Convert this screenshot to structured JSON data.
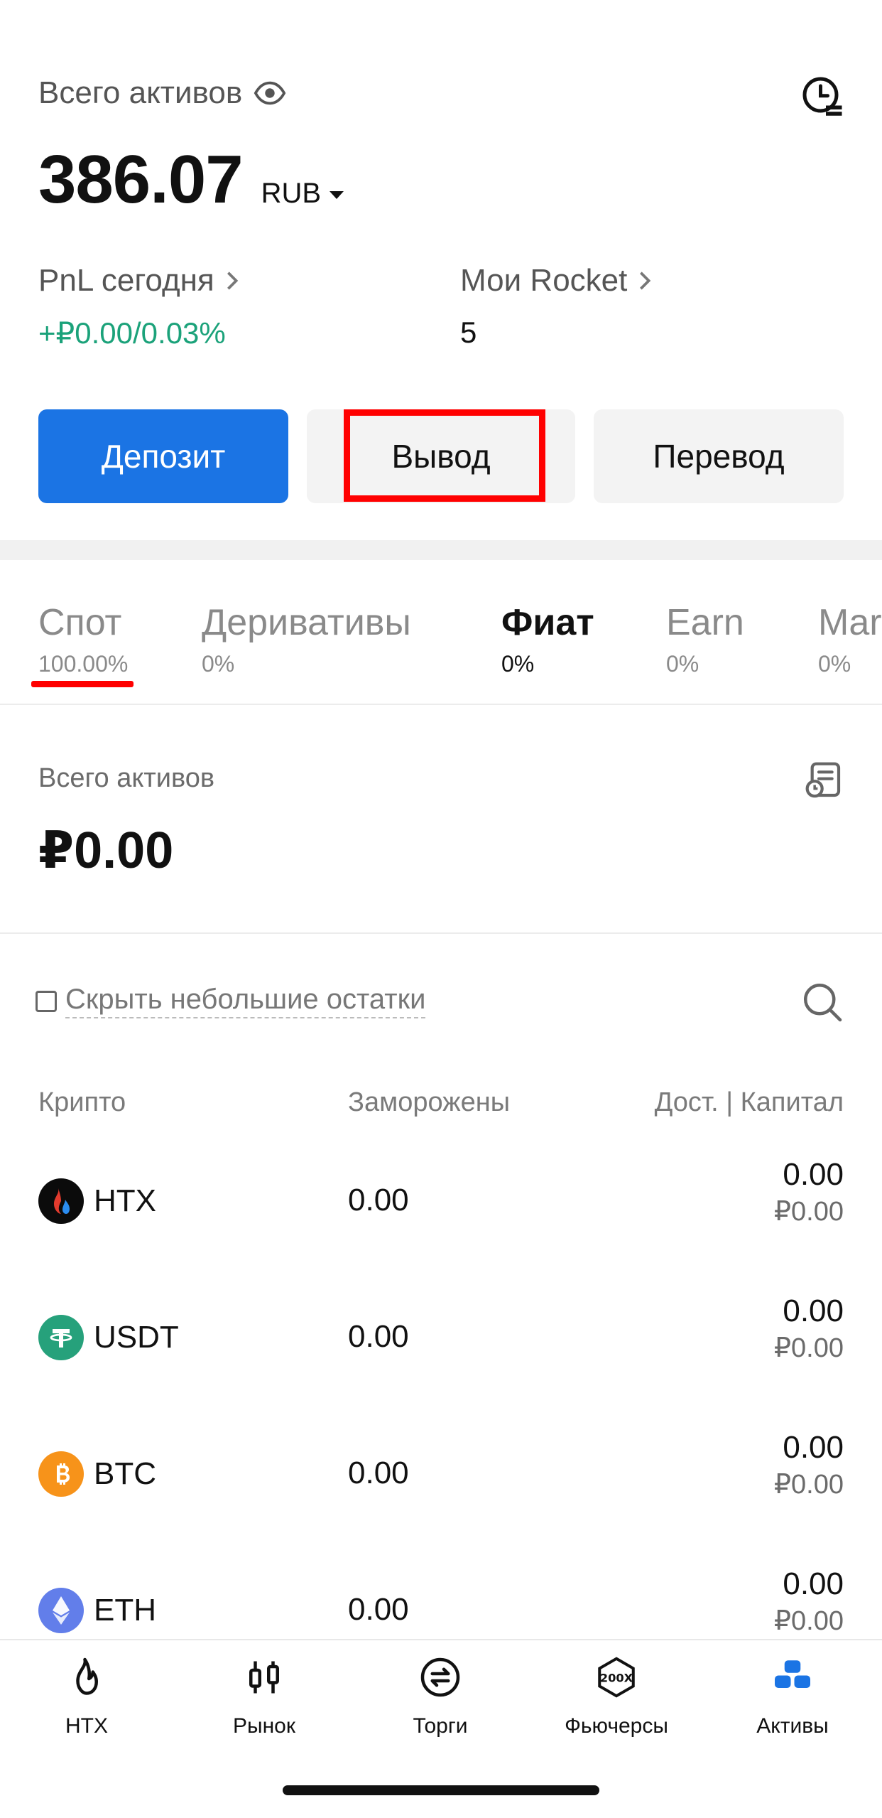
{
  "header": {
    "total_label": "Всего активов",
    "balance": "386.07",
    "currency": "RUB",
    "pnl_label": "PnL сегодня",
    "pnl_value": "+₽0.00/0.03%",
    "rocket_label": "Мои Rocket",
    "rocket_value": "5"
  },
  "buttons": {
    "deposit": "Депозит",
    "withdraw": "Вывод",
    "transfer": "Перевод"
  },
  "tabs": [
    {
      "label": "Спот",
      "pct": "100.00%"
    },
    {
      "label": "Деривативы",
      "pct": "0%"
    },
    {
      "label": "Фиат",
      "pct": "0%"
    },
    {
      "label": "Earn",
      "pct": "0%"
    },
    {
      "label": "Mar",
      "pct": "0%"
    }
  ],
  "section": {
    "assets_label": "Всего активов",
    "assets_value": "₽0.00",
    "hide_small": "Скрыть небольшие остатки"
  },
  "columns": {
    "crypto": "Крипто",
    "frozen": "Заморожены",
    "available": "Дост. | Капитал"
  },
  "rows": [
    {
      "name": "HTX",
      "frozen": "0.00",
      "avail": "0.00",
      "value": "₽0.00"
    },
    {
      "name": "USDT",
      "frozen": "0.00",
      "avail": "0.00",
      "value": "₽0.00"
    },
    {
      "name": "BTC",
      "frozen": "0.00",
      "avail": "0.00",
      "value": "₽0.00"
    },
    {
      "name": "ETH",
      "frozen": "0.00",
      "avail": "0.00",
      "value": "₽0.00"
    }
  ],
  "nav": [
    {
      "label": "HTX"
    },
    {
      "label": "Рынок"
    },
    {
      "label": "Торги"
    },
    {
      "label": "Фьючерсы"
    },
    {
      "label": "Активы"
    }
  ],
  "colors": {
    "accent": "#1b74e4",
    "positive": "#1ba27a",
    "highlight": "#ff0000"
  }
}
